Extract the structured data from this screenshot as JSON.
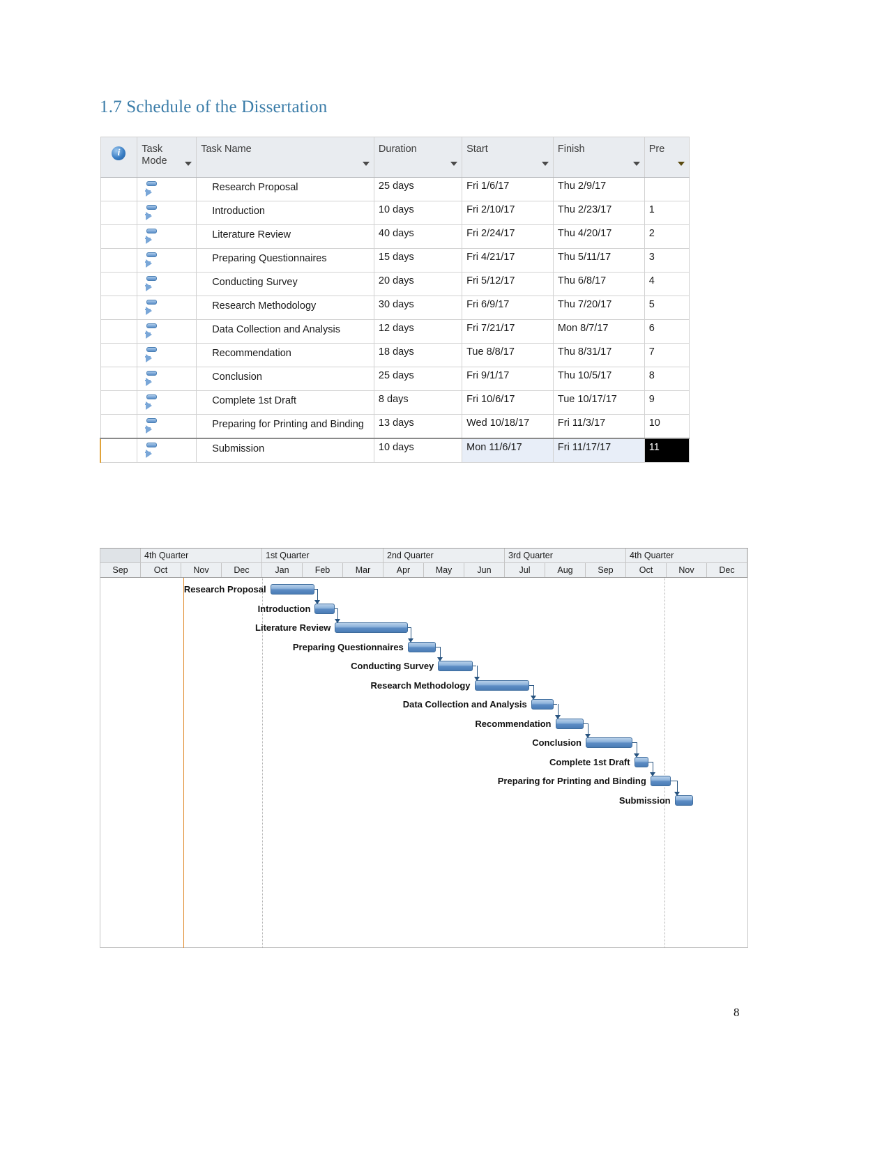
{
  "heading": "1.7 Schedule of the Dissertation",
  "page_number": "8",
  "table": {
    "columns": [
      {
        "key": "indicator",
        "label": "",
        "icon": "info-icon"
      },
      {
        "key": "task_mode",
        "label": "Task Mode"
      },
      {
        "key": "task_name",
        "label": "Task Name"
      },
      {
        "key": "duration",
        "label": "Duration"
      },
      {
        "key": "start",
        "label": "Start"
      },
      {
        "key": "finish",
        "label": "Finish"
      },
      {
        "key": "predecessors",
        "label": "Pre"
      }
    ],
    "header_accent_color": "#ffe27a",
    "rows": [
      {
        "task_name": "Research Proposal",
        "duration": "25 days",
        "start": "Fri 1/6/17",
        "finish": "Thu 2/9/17",
        "pre": ""
      },
      {
        "task_name": "Introduction",
        "duration": "10 days",
        "start": "Fri 2/10/17",
        "finish": "Thu 2/23/17",
        "pre": "1"
      },
      {
        "task_name": "Literature Review",
        "duration": "40 days",
        "start": "Fri 2/24/17",
        "finish": "Thu 4/20/17",
        "pre": "2"
      },
      {
        "task_name": "Preparing Questionnaires",
        "duration": "15 days",
        "start": "Fri 4/21/17",
        "finish": "Thu 5/11/17",
        "pre": "3"
      },
      {
        "task_name": "Conducting Survey",
        "duration": "20 days",
        "start": "Fri 5/12/17",
        "finish": "Thu 6/8/17",
        "pre": "4"
      },
      {
        "task_name": "Research Methodology",
        "duration": "30 days",
        "start": "Fri 6/9/17",
        "finish": "Thu 7/20/17",
        "pre": "5"
      },
      {
        "task_name": "Data Collection and Analysis",
        "duration": "12 days",
        "start": "Fri 7/21/17",
        "finish": "Mon 8/7/17",
        "pre": "6"
      },
      {
        "task_name": "Recommendation",
        "duration": "18 days",
        "start": "Tue 8/8/17",
        "finish": "Thu 8/31/17",
        "pre": "7"
      },
      {
        "task_name": "Conclusion",
        "duration": "25 days",
        "start": "Fri 9/1/17",
        "finish": "Thu 10/5/17",
        "pre": "8"
      },
      {
        "task_name": "Complete 1st Draft",
        "duration": "8 days",
        "start": "Fri 10/6/17",
        "finish": "Tue 10/17/17",
        "pre": "9"
      },
      {
        "task_name": "Preparing for Printing and Binding",
        "duration": "13 days",
        "start": "Wed 10/18/17",
        "finish": "Fri 11/3/17",
        "pre": "10"
      },
      {
        "task_name": "Submission",
        "duration": "10 days",
        "start": "Mon 11/6/17",
        "finish": "Fri 11/17/17",
        "pre": "11",
        "selected": true
      }
    ]
  },
  "chart_data": {
    "type": "bar",
    "title": "",
    "xlabel": "",
    "ylabel": "",
    "quarters": [
      {
        "label": "4th Quarter",
        "months": 3
      },
      {
        "label": "1st Quarter",
        "months": 3
      },
      {
        "label": "2nd Quarter",
        "months": 3
      },
      {
        "label": "3rd Quarter",
        "months": 3
      },
      {
        "label": "4th Quarter",
        "months": 3
      }
    ],
    "months": [
      "Sep",
      "Oct",
      "Nov",
      "Dec",
      "Jan",
      "Feb",
      "Mar",
      "Apr",
      "May",
      "Jun",
      "Jul",
      "Aug",
      "Sep",
      "Oct",
      "Nov",
      "Dec"
    ],
    "bar_color": "#5c8cc4",
    "tasks": [
      {
        "name": "Research Proposal",
        "start": "Fri 1/6/17",
        "finish": "Thu 2/9/17",
        "duration_days": 25,
        "start_month_index": 4.2,
        "end_month_index": 5.3
      },
      {
        "name": "Introduction",
        "start": "Fri 2/10/17",
        "finish": "Thu 2/23/17",
        "duration_days": 10,
        "start_month_index": 5.3,
        "end_month_index": 5.8
      },
      {
        "name": "Literature Review",
        "start": "Fri 2/24/17",
        "finish": "Thu 4/20/17",
        "duration_days": 40,
        "start_month_index": 5.8,
        "end_month_index": 7.6
      },
      {
        "name": "Preparing Questionnaires",
        "start": "Fri 4/21/17",
        "finish": "Thu 5/11/17",
        "duration_days": 15,
        "start_month_index": 7.6,
        "end_month_index": 8.3
      },
      {
        "name": "Conducting Survey",
        "start": "Fri 5/12/17",
        "finish": "Thu 6/8/17",
        "duration_days": 20,
        "start_month_index": 8.35,
        "end_month_index": 9.2
      },
      {
        "name": "Research Methodology",
        "start": "Fri 6/9/17",
        "finish": "Thu 7/20/17",
        "duration_days": 30,
        "start_month_index": 9.25,
        "end_month_index": 10.6
      },
      {
        "name": "Data Collection and Analysis",
        "start": "Fri 7/21/17",
        "finish": "Mon 8/7/17",
        "duration_days": 12,
        "start_month_index": 10.65,
        "end_month_index": 11.2
      },
      {
        "name": "Recommendation",
        "start": "Tue 8/8/17",
        "finish": "Thu 8/31/17",
        "duration_days": 18,
        "start_month_index": 11.25,
        "end_month_index": 11.95
      },
      {
        "name": "Conclusion",
        "start": "Fri 9/1/17",
        "finish": "Thu 10/5/17",
        "duration_days": 25,
        "start_month_index": 12.0,
        "end_month_index": 13.15
      },
      {
        "name": "Complete 1st Draft",
        "start": "Fri 10/6/17",
        "finish": "Tue 10/17/17",
        "duration_days": 8,
        "start_month_index": 13.2,
        "end_month_index": 13.55
      },
      {
        "name": "Preparing for Printing and Binding",
        "start": "Wed 10/18/17",
        "finish": "Fri 11/3/17",
        "duration_days": 13,
        "start_month_index": 13.6,
        "end_month_index": 14.1
      },
      {
        "name": "Submission",
        "start": "Mon 11/6/17",
        "finish": "Fri 11/17/17",
        "duration_days": 10,
        "start_month_index": 14.2,
        "end_month_index": 14.65
      }
    ]
  }
}
